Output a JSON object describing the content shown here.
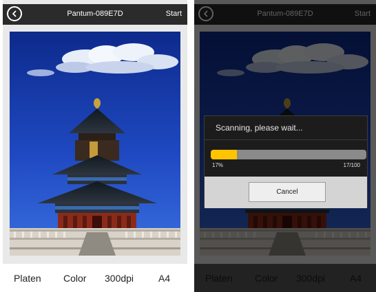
{
  "left_screen": {
    "header": {
      "title": "Pantum-089E7D",
      "start_label": "Start"
    },
    "footer": {
      "source": "Platen",
      "color_mode": "Color",
      "resolution": "300dpi",
      "paper_size": "A4"
    }
  },
  "right_screen": {
    "header": {
      "title": "Pantum-089E7D",
      "start_label": "Start"
    },
    "dialog": {
      "message": "Scanning, please wait...",
      "progress_percent_label": "17%",
      "progress_count_label": "17/100",
      "progress_value": 0.17,
      "cancel_label": "Cancel"
    },
    "footer": {
      "source": "Platen",
      "color_mode": "Color",
      "resolution": "300dpi",
      "paper_size": "A4"
    }
  },
  "icons": {
    "back": "back-arrow-icon"
  },
  "colors": {
    "header_bg": "#2b2b2b",
    "progress_fill": "#ffc400",
    "sky": "#1c3ab0"
  }
}
